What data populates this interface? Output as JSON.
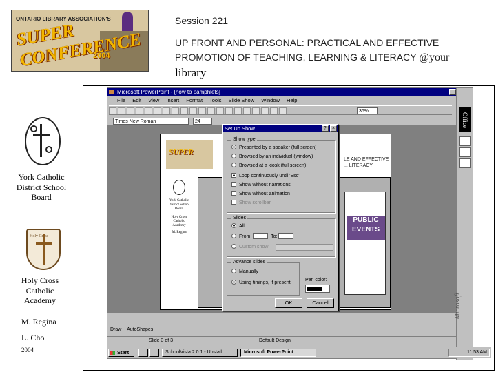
{
  "logo": {
    "topline": "ONTARIO LIBRARY ASSOCIATION'S",
    "super": "SUPER",
    "conference": "CONFERENCE",
    "year": "2004"
  },
  "header": {
    "session": "Session 221",
    "title": "UP FRONT AND PERSONAL: PRACTICAL AND EFFECTIVE PROMOTION OF TEACHING, LEARNING & LITERACY",
    "at_your": "@your",
    "library": "library"
  },
  "left": {
    "board": "York Catholic District School Board",
    "shield_text": "Holy Cross",
    "school": "Holy Cross Catholic Academy",
    "author1": "M. Regina",
    "author2": "L. Cho",
    "year": "2004"
  },
  "screenshot": {
    "app_title": "Microsoft PowerPoint - [how to pamphlets]",
    "menu": [
      "File",
      "Edit",
      "View",
      "Insert",
      "Format",
      "Tools",
      "Slide Show",
      "Window",
      "Help"
    ],
    "font_name": "Times New Roman",
    "font_size": "24",
    "zoom": "36%",
    "office_label": "Office",
    "microsoft_label": "Microsoft",
    "mini_title": "LE AND EFFECTIVE ... LITERACY",
    "mini_big": "PUBLIC EVENTS",
    "dialog": {
      "title": "Set Up Show",
      "show_type_label": "Show type",
      "show_type_options": [
        "Presented by a speaker (full screen)",
        "Browsed by an individual (window)",
        "Browsed at a kiosk (full screen)"
      ],
      "checkboxes": [
        "Loop continuously until 'Esc'",
        "Show without narrations",
        "Show without animation",
        "Show scrollbar"
      ],
      "slides_label": "Slides",
      "slides_all": "All",
      "slides_from": "From:",
      "slides_to": "To:",
      "custom_show": "Custom show:",
      "advance_label": "Advance slides",
      "advance_manual": "Manually",
      "advance_timings": "Using timings, if present",
      "pen_color": "Pen color:",
      "ok": "OK",
      "cancel": "Cancel"
    },
    "draw_label": "Draw",
    "autoshapes": "AutoShapes",
    "status_slide": "Slide 3 of 3",
    "status_design": "Default Design",
    "taskbar": {
      "start": "Start",
      "items": [
        "SchoolVista 2.0.1 - Ubstall",
        "Microsoft PowerPoint"
      ],
      "clock": "11:53 AM"
    }
  }
}
